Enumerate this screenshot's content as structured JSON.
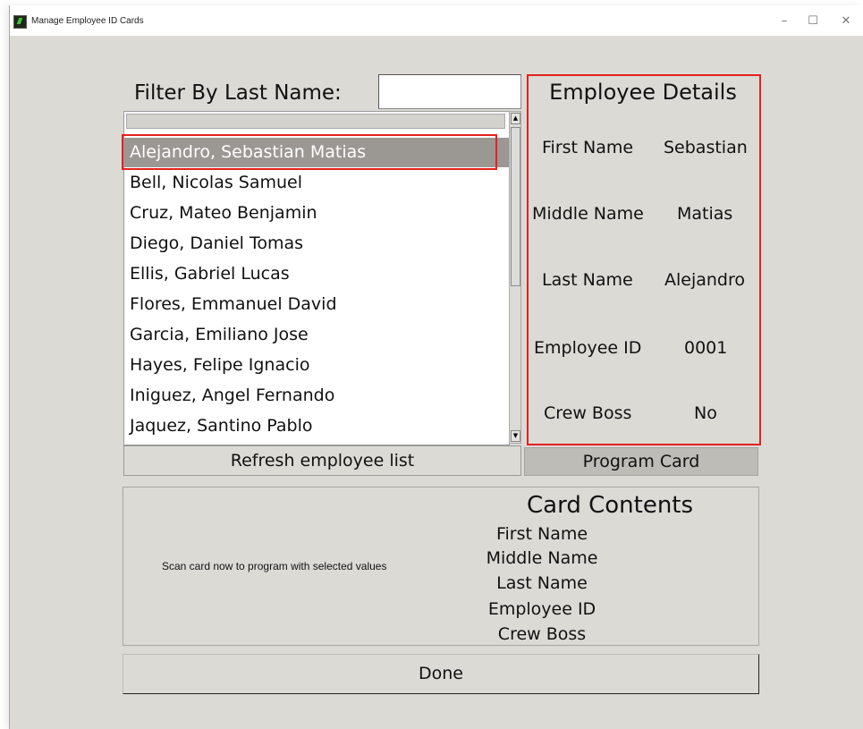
{
  "window": {
    "title": "Manage Employee ID Cards",
    "controls": {
      "minimize": "–",
      "maximize": "☐",
      "close": "✕"
    }
  },
  "filter": {
    "label": "Filter By Last Name:",
    "value": ""
  },
  "employee_list": {
    "items": [
      "Alejandro, Sebastian Matias",
      "Bell, Nicolas Samuel",
      "Cruz, Mateo Benjamin",
      "Diego, Daniel Tomas",
      "Ellis, Gabriel Lucas",
      "Flores, Emmanuel David",
      "Garcia, Emiliano Jose",
      "Hayes, Felipe Ignacio",
      "Iniguez, Angel Fernando",
      "Jaquez, Santino Pablo"
    ],
    "selected_index": 0,
    "refresh_label": "Refresh employee list"
  },
  "details": {
    "title": "Employee Details",
    "fields": [
      {
        "label": "First Name",
        "value": "Sebastian"
      },
      {
        "label": "Middle Name",
        "value": "Matias"
      },
      {
        "label": "Last Name",
        "value": "Alejandro"
      },
      {
        "label": "Employee ID",
        "value": "0001"
      },
      {
        "label": "Crew Boss",
        "value": "No"
      }
    ],
    "program_label": "Program Card"
  },
  "card": {
    "title": "Card Contents",
    "scan_message": "Scan card now to program with selected values",
    "fields": [
      "First Name",
      "Middle Name",
      "Last Name",
      "Employee ID",
      "Crew Boss"
    ]
  },
  "done_label": "Done",
  "colors": {
    "window_bg": "#dcdad5",
    "selected_row": "#9b9893",
    "highlight": "#e52020"
  }
}
